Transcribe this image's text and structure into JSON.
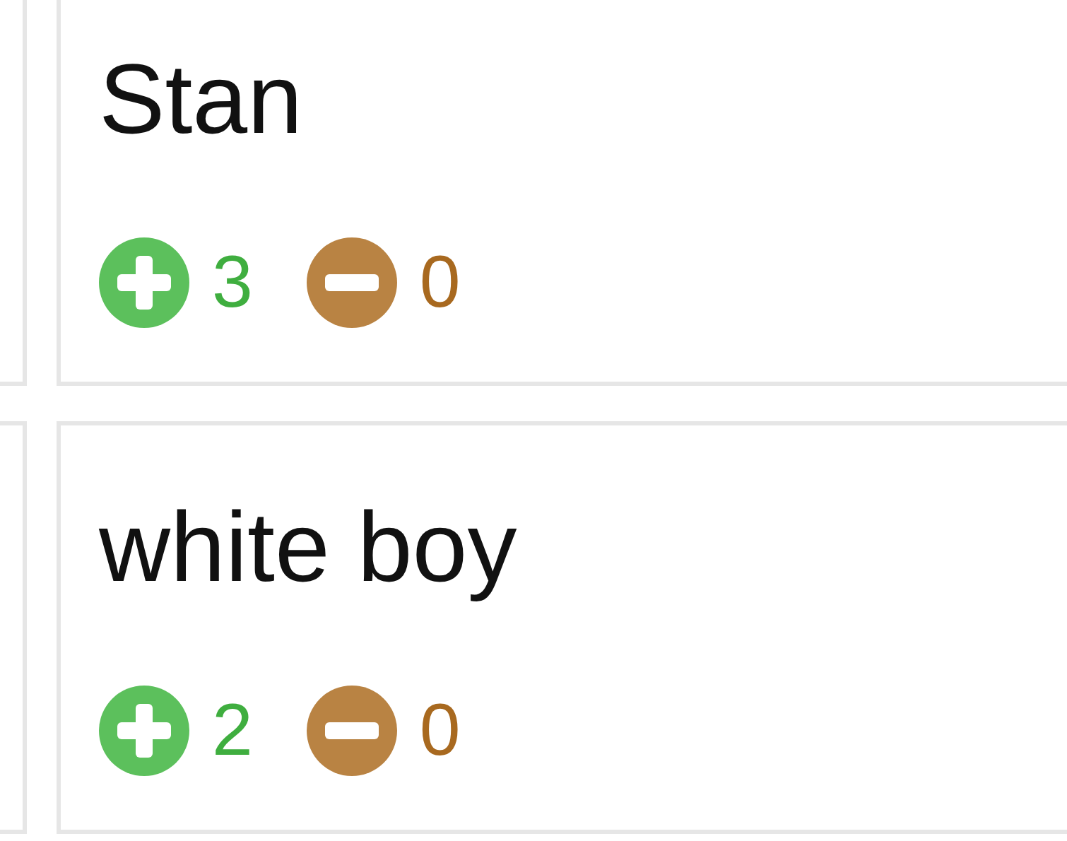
{
  "cards": [
    {
      "name": "Stan",
      "upvotes": "3",
      "downvotes": "0"
    },
    {
      "name": "white boy",
      "upvotes": "2",
      "downvotes": "0"
    }
  ]
}
